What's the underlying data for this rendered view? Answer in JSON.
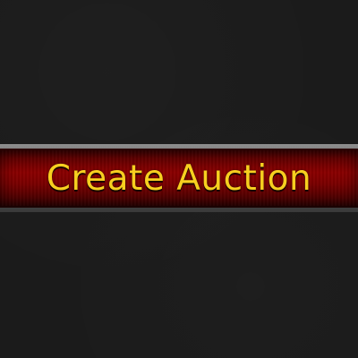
{
  "button": {
    "label": "Create Auction"
  },
  "colors": {
    "background": "#1b1b1b",
    "button_fill": "#8b0000",
    "button_border": "#5d5d5d",
    "label_text": "#f7cf1f"
  }
}
